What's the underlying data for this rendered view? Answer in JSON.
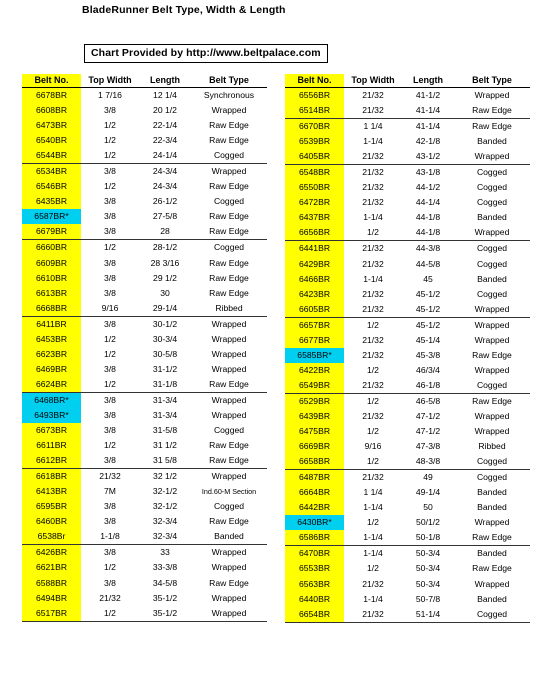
{
  "header": {
    "title": "BladeRunner Belt Type, Width & Length",
    "credit": "Chart Provided by  http://www.beltpalace.com"
  },
  "colors": {
    "highlight_default": "#FFFF00",
    "highlight_special": "#00CFF0",
    "text": "#000000",
    "rule": "#000000"
  },
  "columns": [
    "Belt No.",
    "Top Width",
    "Length",
    "Belt Type"
  ],
  "tables": [
    {
      "id": "left",
      "headers": {
        "belt_no": "Belt No.",
        "top_width": "Top Width",
        "length": "Length",
        "belt_type": "Belt Type"
      },
      "rows": [
        {
          "no": "6678BR",
          "tw": "1   7/16",
          "len": "12 1/4",
          "type": "Synchronous",
          "hl": false,
          "sep": false
        },
        {
          "no": "6608BR",
          "tw": "3/8",
          "len": "20 1/2",
          "type": "Wrapped",
          "hl": false,
          "sep": false
        },
        {
          "no": "6473BR",
          "tw": "1/2",
          "len": "22-1/4",
          "type": "Raw Edge",
          "hl": false,
          "sep": false
        },
        {
          "no": "6540BR",
          "tw": "1/2",
          "len": "22-3/4",
          "type": "Raw Edge",
          "hl": false,
          "sep": false
        },
        {
          "no": "6544BR",
          "tw": "1/2",
          "len": "24-1/4",
          "type": "Cogged",
          "hl": false,
          "sep": true
        },
        {
          "no": "6534BR",
          "tw": "3/8",
          "len": "24-3/4",
          "type": "Wrapped",
          "hl": false,
          "sep": false
        },
        {
          "no": "6546BR",
          "tw": "1/2",
          "len": "24-3/4",
          "type": "Raw Edge",
          "hl": false,
          "sep": false
        },
        {
          "no": "6435BR",
          "tw": "3/8",
          "len": "26-1/2",
          "type": "Cogged",
          "hl": false,
          "sep": false
        },
        {
          "no": "6587BR*",
          "tw": "3/8",
          "len": "27-5/8",
          "type": "Raw Edge",
          "hl": true,
          "sep": false
        },
        {
          "no": "6679BR",
          "tw": "3/8",
          "len": "28",
          "type": "Raw Edge",
          "hl": false,
          "sep": true
        },
        {
          "no": "6660BR",
          "tw": "1/2",
          "len": "28-1/2",
          "type": "Cogged",
          "hl": false,
          "sep": false
        },
        {
          "no": "6609BR",
          "tw": "3/8",
          "len": "28   3/16",
          "type": "Raw Edge",
          "hl": false,
          "sep": false
        },
        {
          "no": "6610BR",
          "tw": "3/8",
          "len": "29 1/2",
          "type": "Raw Edge",
          "hl": false,
          "sep": false
        },
        {
          "no": "6613BR",
          "tw": "3/8",
          "len": "30",
          "type": "Raw Edge",
          "hl": false,
          "sep": false
        },
        {
          "no": "6668BR",
          "tw": "9/16",
          "len": "29-1/4",
          "type": "Ribbed",
          "hl": false,
          "sep": true
        },
        {
          "no": "6411BR",
          "tw": "3/8",
          "len": "30-1/2",
          "type": "Wrapped",
          "hl": false,
          "sep": false
        },
        {
          "no": "6453BR",
          "tw": "1/2",
          "len": "30-3/4",
          "type": "Wrapped",
          "hl": false,
          "sep": false
        },
        {
          "no": "6623BR",
          "tw": "1/2",
          "len": "30-5/8",
          "type": "Wrapped",
          "hl": false,
          "sep": false
        },
        {
          "no": "6469BR",
          "tw": "3/8",
          "len": "31-1/2",
          "type": "Wrapped",
          "hl": false,
          "sep": false
        },
        {
          "no": "6624BR",
          "tw": "1/2",
          "len": "31-1/8",
          "type": "Raw Edge",
          "hl": false,
          "sep": true
        },
        {
          "no": "6468BR*",
          "tw": "3/8",
          "len": "31-3/4",
          "type": "Wrapped",
          "hl": true,
          "sep": false
        },
        {
          "no": "6493BR*",
          "tw": "3/8",
          "len": "31-3/4",
          "type": "Wrapped",
          "hl": true,
          "sep": false
        },
        {
          "no": "6673BR",
          "tw": "3/8",
          "len": "31-5/8",
          "type": "Cogged",
          "hl": false,
          "sep": false
        },
        {
          "no": "6611BR",
          "tw": "1/2",
          "len": "31 1/2",
          "type": "Raw Edge",
          "hl": false,
          "sep": false
        },
        {
          "no": "6612BR",
          "tw": "3/8",
          "len": "31 5/8",
          "type": "Raw Edge",
          "hl": false,
          "sep": true
        },
        {
          "no": "6618BR",
          "tw": "21/32",
          "len": "32 1/2",
          "type": "Wrapped",
          "hl": false,
          "sep": false
        },
        {
          "no": "6413BR",
          "tw": "7M",
          "len": "32-1/2",
          "type": "Ind.60-M Section",
          "hl": false,
          "sep": false,
          "small": true
        },
        {
          "no": "6595BR",
          "tw": "3/8",
          "len": "32-1/2",
          "type": "Cogged",
          "hl": false,
          "sep": false
        },
        {
          "no": "6460BR",
          "tw": "3/8",
          "len": "32-3/4",
          "type": "Raw Edge",
          "hl": false,
          "sep": false
        },
        {
          "no": "6538Br",
          "tw": "1-1/8",
          "len": "32-3/4",
          "type": "Banded",
          "hl": false,
          "sep": true
        },
        {
          "no": "6426BR",
          "tw": "3/8",
          "len": "33",
          "type": "Wrapped",
          "hl": false,
          "sep": false
        },
        {
          "no": "6621BR",
          "tw": "1/2",
          "len": "33-3/8",
          "type": "Wrapped",
          "hl": false,
          "sep": false
        },
        {
          "no": "6588BR",
          "tw": "3/8",
          "len": "34-5/8",
          "type": "Raw Edge",
          "hl": false,
          "sep": false
        },
        {
          "no": "6494BR",
          "tw": "21/32",
          "len": "35-1/2",
          "type": "Wrapped",
          "hl": false,
          "sep": false
        },
        {
          "no": "6517BR",
          "tw": "1/2",
          "len": "35-1/2",
          "type": "Wrapped",
          "hl": false,
          "sep": true
        }
      ]
    },
    {
      "id": "right",
      "headers": {
        "belt_no": "Belt No.",
        "top_width": "Top Width",
        "length": "Length",
        "belt_type": "Belt Type"
      },
      "rows": [
        {
          "no": "6556BR",
          "tw": "21/32",
          "len": "41-1/2",
          "type": "Wrapped",
          "hl": false,
          "sep": false
        },
        {
          "no": "6514BR",
          "tw": "21/32",
          "len": "41-1/4",
          "type": "Raw Edge",
          "hl": false,
          "sep": true
        },
        {
          "no": "6670BR",
          "tw": "1    1/4",
          "len": "41-1/4",
          "type": "Raw Edge",
          "hl": false,
          "sep": false
        },
        {
          "no": "6539BR",
          "tw": "1-1/4",
          "len": "42-1/8",
          "type": "Banded",
          "hl": false,
          "sep": false
        },
        {
          "no": "6405BR",
          "tw": "21/32",
          "len": "43-1/2",
          "type": "Wrapped",
          "hl": false,
          "sep": true
        },
        {
          "no": "6548BR",
          "tw": "21/32",
          "len": "43-1/8",
          "type": "Cogged",
          "hl": false,
          "sep": false
        },
        {
          "no": "6550BR",
          "tw": "21/32",
          "len": "44-1/2",
          "type": "Cogged",
          "hl": false,
          "sep": false
        },
        {
          "no": "6472BR",
          "tw": "21/32",
          "len": "44-1/4",
          "type": "Cogged",
          "hl": false,
          "sep": false
        },
        {
          "no": "6437BR",
          "tw": "1-1/4",
          "len": "44-1/8",
          "type": "Banded",
          "hl": false,
          "sep": false
        },
        {
          "no": "6656BR",
          "tw": "1/2",
          "len": "44-1/8",
          "type": "Wrapped",
          "hl": false,
          "sep": true
        },
        {
          "no": "6441BR",
          "tw": "21/32",
          "len": "44-3/8",
          "type": "Cogged",
          "hl": false,
          "sep": false
        },
        {
          "no": "6429BR",
          "tw": "21/32",
          "len": "44-5/8",
          "type": "Cogged",
          "hl": false,
          "sep": false
        },
        {
          "no": "6466BR",
          "tw": "1-1/4",
          "len": "45",
          "type": "Banded",
          "hl": false,
          "sep": false
        },
        {
          "no": "6423BR",
          "tw": "21/32",
          "len": "45-1/2",
          "type": "Cogged",
          "hl": false,
          "sep": false
        },
        {
          "no": "6605BR",
          "tw": "21/32",
          "len": "45-1/2",
          "type": "Wrapped",
          "hl": false,
          "sep": true
        },
        {
          "no": "6657BR",
          "tw": "1/2",
          "len": "45-1/2",
          "type": "Wrapped",
          "hl": false,
          "sep": false
        },
        {
          "no": "6677BR",
          "tw": "21/32",
          "len": "45-1/4",
          "type": "Wrapped",
          "hl": false,
          "sep": false
        },
        {
          "no": "6585BR*",
          "tw": "21/32",
          "len": "45-3/8",
          "type": "Raw Edge",
          "hl": true,
          "sep": false
        },
        {
          "no": "6422BR",
          "tw": "1/2",
          "len": "46/3/4",
          "type": "Wrapped",
          "hl": false,
          "sep": false
        },
        {
          "no": "6549BR",
          "tw": "21/32",
          "len": "46-1/8",
          "type": "Cogged",
          "hl": false,
          "sep": true
        },
        {
          "no": "6529BR",
          "tw": "1/2",
          "len": "46-5/8",
          "type": "Raw Edge",
          "hl": false,
          "sep": false
        },
        {
          "no": "6439BR",
          "tw": "21/32",
          "len": "47-1/2",
          "type": "Wrapped",
          "hl": false,
          "sep": false
        },
        {
          "no": "6475BR",
          "tw": "1/2",
          "len": "47-1/2",
          "type": "Wrapped",
          "hl": false,
          "sep": false
        },
        {
          "no": "6669BR",
          "tw": "9/16",
          "len": "47-3/8",
          "type": "Ribbed",
          "hl": false,
          "sep": false
        },
        {
          "no": "6658BR",
          "tw": "1/2",
          "len": "48-3/8",
          "type": "Cogged",
          "hl": false,
          "sep": true
        },
        {
          "no": "6487BR",
          "tw": "21/32",
          "len": "49",
          "type": "Cogged",
          "hl": false,
          "sep": false
        },
        {
          "no": "6664BR",
          "tw": "1 1/4",
          "len": "49-1/4",
          "type": "Banded",
          "hl": false,
          "sep": false
        },
        {
          "no": "6442BR",
          "tw": "1-1/4",
          "len": "50",
          "type": "Banded",
          "hl": false,
          "sep": false
        },
        {
          "no": "6430BR*",
          "tw": "1/2",
          "len": "50/1/2",
          "type": "Wrapped",
          "hl": true,
          "sep": false
        },
        {
          "no": "6586BR",
          "tw": "1-1/4",
          "len": "50-1/8",
          "type": "Raw Edge",
          "hl": false,
          "sep": true
        },
        {
          "no": "6470BR",
          "tw": "1-1/4",
          "len": "50-3/4",
          "type": "Banded",
          "hl": false,
          "sep": false
        },
        {
          "no": "6553BR",
          "tw": "1/2",
          "len": "50-3/4",
          "type": "Raw Edge",
          "hl": false,
          "sep": false
        },
        {
          "no": "6563BR",
          "tw": "21/32",
          "len": "50-3/4",
          "type": "Wrapped",
          "hl": false,
          "sep": false
        },
        {
          "no": "6440BR",
          "tw": "1-1/4",
          "len": "50-7/8",
          "type": "Banded",
          "hl": false,
          "sep": false
        },
        {
          "no": "6654BR",
          "tw": "21/32",
          "len": "51-1/4",
          "type": "Cogged",
          "hl": false,
          "sep": true
        }
      ]
    }
  ]
}
